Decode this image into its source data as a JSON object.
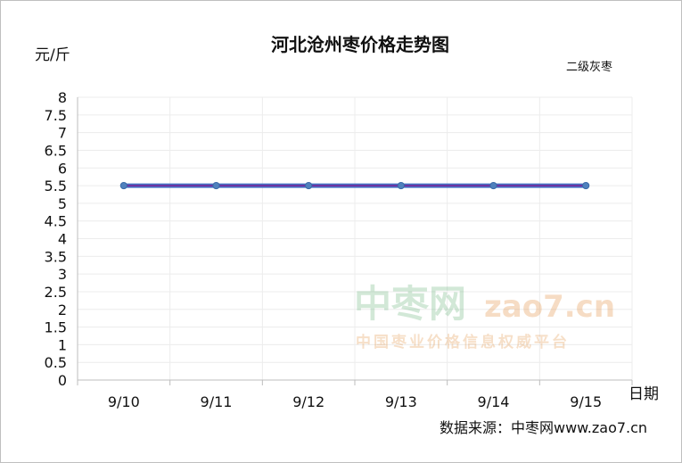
{
  "chart_data": {
    "type": "line",
    "title": "河北沧州枣价格走势图",
    "ylabel": "元/斤",
    "xlabel": "日期",
    "categories": [
      "9/10",
      "9/11",
      "9/12",
      "9/13",
      "9/14",
      "9/15"
    ],
    "series": [
      {
        "name": "二级灰枣",
        "values": [
          5.5,
          5.5,
          5.5,
          5.5,
          5.5,
          5.5
        ]
      }
    ],
    "ylim": [
      0,
      8
    ],
    "yticks": [
      "0",
      "0.5",
      "1",
      "1.5",
      "2",
      "2.5",
      "3",
      "3.5",
      "4",
      "4.5",
      "5",
      "5.5",
      "6",
      "6.5",
      "7",
      "7.5",
      "8"
    ],
    "grid": true,
    "legend": "top-right",
    "source": "数据来源：中枣网www.zao7.cn",
    "colors": {
      "line": "#7030a0",
      "line_outer": "#4472c4",
      "marker": "#4f81bd"
    }
  },
  "watermark": {
    "brand": "中枣网",
    "domain": "zao7.cn",
    "slogan": "中国枣业价格信息权威平台"
  }
}
